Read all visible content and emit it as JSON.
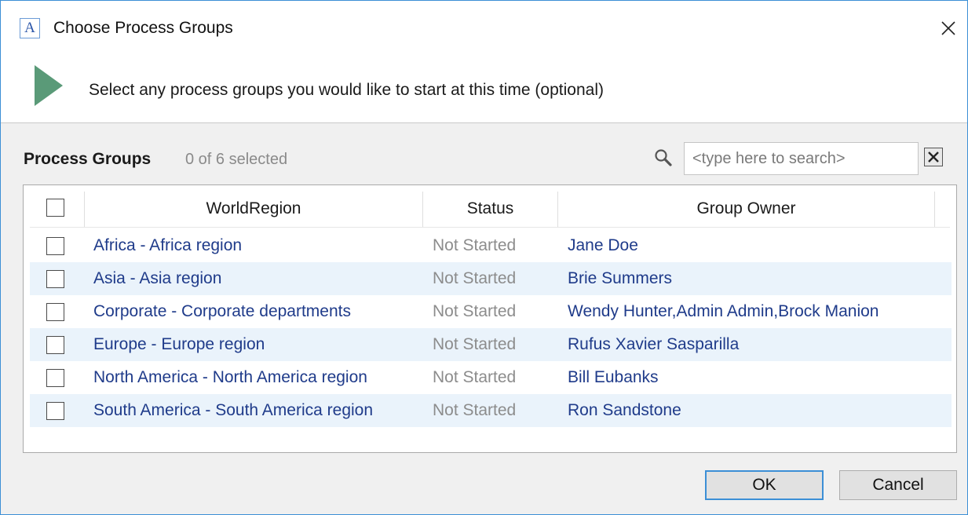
{
  "window": {
    "app_icon_letter": "A",
    "title": "Choose Process Groups"
  },
  "banner": {
    "instruction": "Select any process groups you would like to start at this time (optional)"
  },
  "list": {
    "label": "Process Groups",
    "selected_count": "0 of 6 selected",
    "search_placeholder": "<type here to search>",
    "columns": {
      "region": "WorldRegion",
      "status": "Status",
      "owner": "Group Owner"
    },
    "rows": [
      {
        "region": "Africa - Africa region",
        "status": "Not Started",
        "owner": "Jane Doe",
        "checked": false
      },
      {
        "region": "Asia - Asia region",
        "status": "Not Started",
        "owner": "Brie Summers",
        "checked": false
      },
      {
        "region": "Corporate - Corporate departments",
        "status": "Not Started",
        "owner": "Wendy Hunter,Admin Admin,Brock Manion",
        "checked": false
      },
      {
        "region": "Europe - Europe region",
        "status": "Not Started",
        "owner": "Rufus Xavier Sasparilla",
        "checked": false
      },
      {
        "region": "North America - North America region",
        "status": "Not Started",
        "owner": "Bill Eubanks",
        "checked": false
      },
      {
        "region": "South America - South America region",
        "status": "Not Started",
        "owner": "Ron Sandstone",
        "checked": false
      }
    ]
  },
  "footer": {
    "ok_label": "OK",
    "cancel_label": "Cancel"
  },
  "colors": {
    "accent": "#3c8fd6",
    "play_icon": "#5a9a78",
    "link_text": "#1f3b8a",
    "row_alt": "#eaf3fb"
  }
}
